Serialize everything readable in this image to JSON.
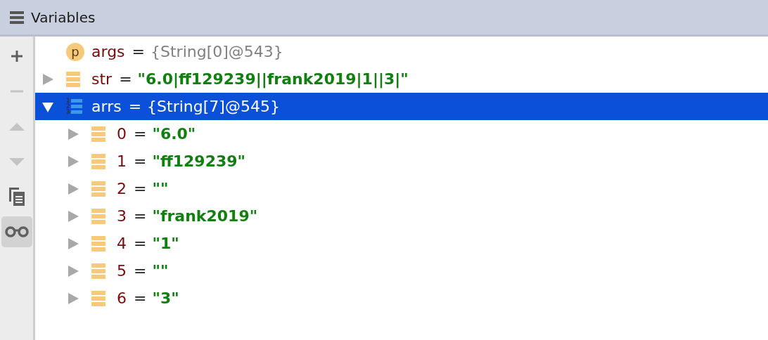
{
  "panel": {
    "title": "Variables"
  },
  "toolbar": [
    {
      "kind": "add",
      "disabled": false,
      "selected": false
    },
    {
      "kind": "remove",
      "disabled": true,
      "selected": false
    },
    {
      "kind": "up",
      "disabled": true,
      "selected": false
    },
    {
      "kind": "down",
      "disabled": true,
      "selected": false
    },
    {
      "kind": "copy",
      "disabled": false,
      "selected": false
    },
    {
      "kind": "watches",
      "disabled": false,
      "selected": true
    }
  ],
  "variables": [
    {
      "kind": "param",
      "icon_letter": "p",
      "name": "args",
      "operator": "=",
      "value": "{String[0]@543}",
      "selected": false
    },
    {
      "kind": "field",
      "name": "str",
      "operator": "=",
      "value": "\"6.0|ff129239||frank2019|1||3|\"",
      "expanded": false,
      "selected": false
    },
    {
      "kind": "array",
      "icon_digits": [
        "1",
        "2",
        "3"
      ],
      "name": "arrs",
      "operator": "=",
      "value": "{String[7]@545}",
      "expanded": true,
      "selected": true,
      "children": [
        {
          "kind": "field",
          "name": "0",
          "operator": "=",
          "value": "\"6.0\"",
          "expanded": false,
          "selected": false
        },
        {
          "kind": "field",
          "name": "1",
          "operator": "=",
          "value": "\"ff129239\"",
          "expanded": false,
          "selected": false
        },
        {
          "kind": "field",
          "name": "2",
          "operator": "=",
          "value": "\"\"",
          "expanded": false,
          "selected": false
        },
        {
          "kind": "field",
          "name": "3",
          "operator": "=",
          "value": "\"frank2019\"",
          "expanded": false,
          "selected": false
        },
        {
          "kind": "field",
          "name": "4",
          "operator": "=",
          "value": "\"1\"",
          "expanded": false,
          "selected": false
        },
        {
          "kind": "field",
          "name": "5",
          "operator": "=",
          "value": "\"\"",
          "expanded": false,
          "selected": false
        },
        {
          "kind": "field",
          "name": "6",
          "operator": "=",
          "value": "\"3\"",
          "expanded": false,
          "selected": false
        }
      ]
    }
  ]
}
